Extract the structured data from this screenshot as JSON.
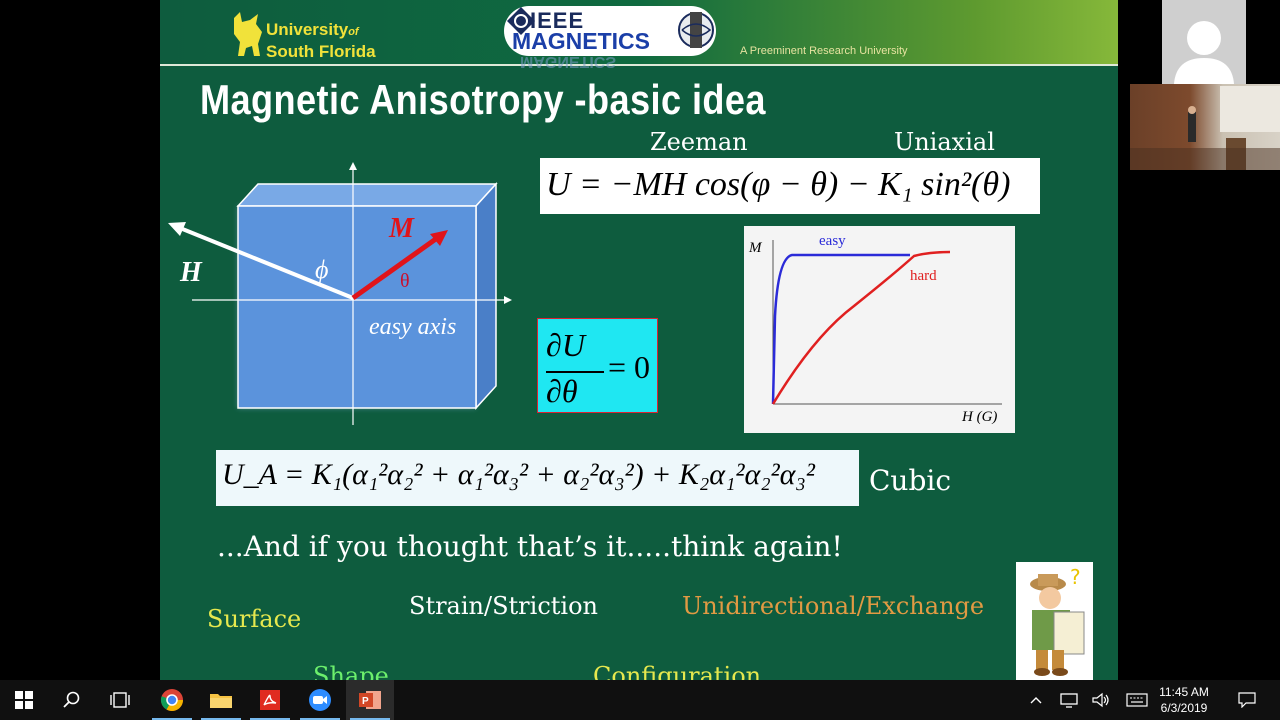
{
  "slide": {
    "header": {
      "usf_line1": "University",
      "usf_line1_small": "of",
      "usf_line2": "South Florida",
      "ieee_top": "IEEE",
      "ieee_bottom": "MAGNETICS",
      "ieee_reflection": "MAGNETICS",
      "tagline": "A Preeminent Research University"
    },
    "title": "Magnetic Anisotropy -basic idea",
    "label_zeeman": "Zeeman",
    "label_uniaxial": "Uniaxial",
    "equation_energy": "U = −MH cos(φ − θ) − K₁ sin²(θ)",
    "derivative": {
      "numerator": "∂U",
      "denominator": "∂θ",
      "equals": "= 0"
    },
    "cube_labels": {
      "H": "H",
      "M": "M",
      "phi": "ϕ",
      "theta": "θ",
      "easy_axis": "easy axis"
    },
    "graph": {
      "y_label": "M",
      "x_label": "H (G)",
      "easy_label": "easy",
      "hard_label": "hard"
    },
    "equation_cubic": "U_A = K₁(α₁²α₂² + α₁²α₃² + α₂²α₃²) + K₂α₁²α₂²α₃²",
    "cubic_label": "Cubic",
    "think_again": "...And if you thought that’s it.....think again!",
    "items": {
      "surface": "Surface",
      "strain": "Strain/Striction",
      "unidirectional": "Unidirectional/Exchange",
      "shape": "Shape",
      "configuration": "Configuration"
    },
    "colors": {
      "background": "#0e5c3e",
      "surface": "#e6e84e",
      "unidirectional": "#e19a43",
      "shape": "#6cf06c",
      "derivative_bg": "#1fe7f2"
    }
  },
  "taskbar": {
    "icons": [
      "windows-start-icon",
      "search-icon",
      "task-view-icon",
      "chrome-icon",
      "file-explorer-icon",
      "acrobat-icon",
      "zoom-icon",
      "powerpoint-icon"
    ],
    "time": "11:45 AM",
    "date": "6/3/2019"
  }
}
